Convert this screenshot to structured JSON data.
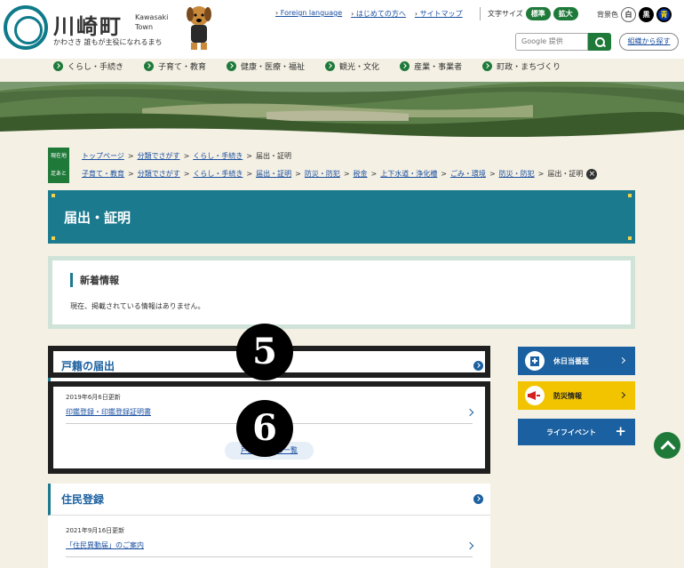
{
  "header": {
    "logo_title": "川崎町",
    "logo_en_line1": "Kawasaki",
    "logo_en_line2": "Town",
    "logo_tagline": "かわさき 誰もが主役になれるまち",
    "top_links": [
      "Foreign language",
      "はじめての方へ",
      "サイトマップ"
    ],
    "font_size_label": "文字サイズ",
    "font_size_standard": "標準",
    "font_size_large": "拡大",
    "bg_color_label": "背景色",
    "bg_white": "白",
    "bg_black": "黒",
    "bg_blue": "青",
    "search_placeholder": "Google 提供",
    "org_search": "組織から探す"
  },
  "global_nav": [
    "くらし・手続き",
    "子育て・教育",
    "健康・医療・福祉",
    "観光・文化",
    "産業・事業者",
    "町政・まちづくり"
  ],
  "breadcrumbs": {
    "current_tag": "現在地",
    "current": [
      "トップページ",
      "分類でさがす",
      "くらし・手続き",
      "届出・証明"
    ],
    "history_tag": "足あと",
    "history": [
      "子育て・教育",
      "分類でさがす",
      "くらし・手続き",
      "届出・証明",
      "防災・防犯",
      "税金",
      "上下水道・浄化槽",
      "ごみ・環境",
      "防災・防犯",
      "届出・証明"
    ]
  },
  "page_title": "届出・証明",
  "news": {
    "heading": "新着情報",
    "body": "現在、掲載されている情報はありません。"
  },
  "sections": [
    {
      "title": "戸籍の届出",
      "date": "2019年6月6日更新",
      "link": "印鑑登録・印鑑登録証明書",
      "list_button": "戸籍の届出の一覧"
    },
    {
      "title": "住民登録",
      "date": "2021年9月16日更新",
      "link": "「住民異動届」のご案内"
    }
  ],
  "badges": [
    "5",
    "6"
  ],
  "side_nav": {
    "holiday_doctor": "休日当番医",
    "disaster": "防災情報",
    "life_event": "ライフイベント"
  },
  "colors": {
    "teal": "#1b7a8e",
    "green": "#1f7a3a",
    "yellow": "#f2c400",
    "blue": "#1b60a0"
  }
}
